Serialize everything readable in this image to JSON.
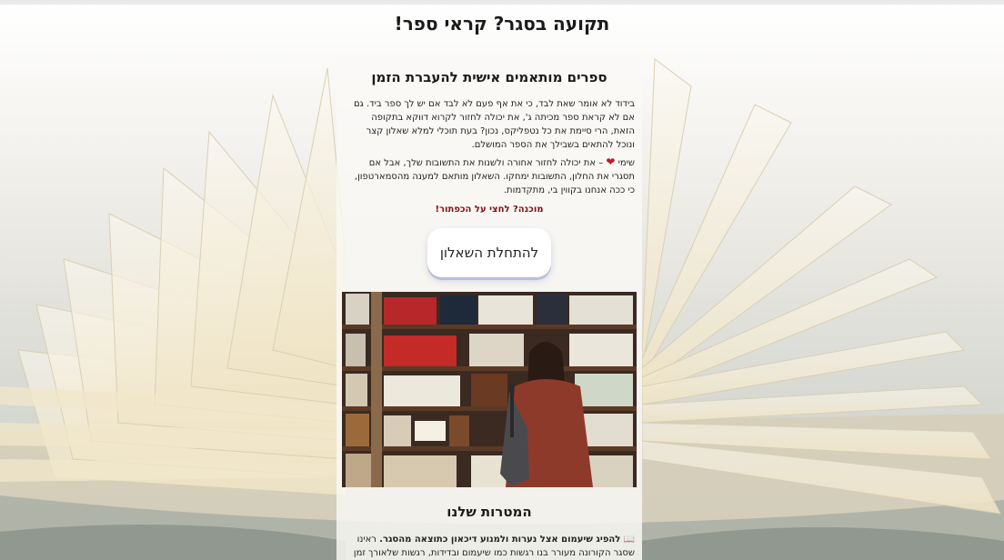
{
  "page": {
    "title": "תקועה בסגר? קראי ספר!"
  },
  "intro": {
    "heading": "ספרים מותאמים אישית להעברת הזמן",
    "paragraph1": "בידוד לא אומר שאת לבד, כי את אף פעם לא לבד אם יש לך ספר ביד. גם אם לא קראת ספר מכיתה ג', את יכולה לחזור לקרוא דווקא בתקופה הזאת, הרי סיימת את כל נטפליקס, נכון? בעת תוכלי למלא שאלון קצר ונוכל להתאים בשבילך את הספר המושלם.",
    "paragraph2_prefix": "שימי",
    "paragraph2_rest": " – את יכולה לחזור אחורה ולשנות את התשובות שלך, אבל אם תסגרי את החלון, התשובות ימחקו. השאלון מותאם למענה מהסמארטפון, כי ככה אנחנו בקווין בי, מתקדמות.",
    "heart_icon": "heart-icon",
    "cta_note": "מוכנה? לחצי על הכפתור!",
    "start_button": "להתחלת השאלון"
  },
  "photo": {
    "icon": "library-photo"
  },
  "goals": {
    "heading": "המטרות שלנו",
    "book_icon": "📖",
    "bold_text": "להפיג שיעמום אצל נערות ולמנוע דיכאון כתוצאה מהסגר.",
    "rest_text": " ראינו שסגר הקורונה מעורר בנו רגשות כמו שיעמום ובדידות, רגשות שלאורך זמן"
  },
  "colors": {
    "accent": "#7a1010",
    "heart": "#c0182b",
    "button_shadow": "#b9bde0"
  }
}
